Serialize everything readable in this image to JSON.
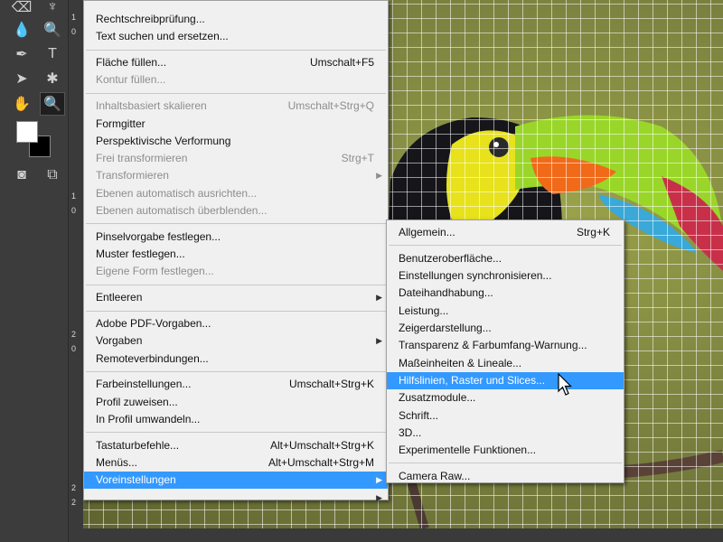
{
  "toolbar": {
    "tools": [
      {
        "icon": "eraser-icon",
        "glyph": "⌫"
      },
      {
        "icon": "paint-bucket-icon",
        "glyph": "♆"
      },
      {
        "icon": "blur-icon",
        "glyph": "💧"
      },
      {
        "icon": "dodge-icon",
        "glyph": "🔍"
      },
      {
        "icon": "pen-icon",
        "glyph": "✒"
      },
      {
        "icon": "type-icon",
        "glyph": "T"
      },
      {
        "icon": "path-select-icon",
        "glyph": "➤"
      },
      {
        "icon": "custom-shape-icon",
        "glyph": "✱"
      },
      {
        "icon": "hand-icon",
        "glyph": "✋"
      },
      {
        "icon": "zoom-icon",
        "glyph": "🔍"
      },
      {
        "icon": "quick-mask-icon",
        "glyph": "◙"
      },
      {
        "icon": "screen-mode-icon",
        "glyph": "⧉"
      }
    ],
    "foreground_color": "#ffffff",
    "background_color": "#000000"
  },
  "ruler": {
    "labels": [
      "1",
      "0",
      "1",
      "0",
      "2",
      "0",
      "2",
      "2"
    ]
  },
  "edit_menu": {
    "groups": [
      [
        {
          "label": "Rechtschreibprüfung...",
          "shortcut": "",
          "disabled": false
        },
        {
          "label": "Text suchen und ersetzen...",
          "shortcut": "",
          "disabled": false
        }
      ],
      [
        {
          "label": "Fläche füllen...",
          "shortcut": "Umschalt+F5",
          "disabled": false
        },
        {
          "label": "Kontur füllen...",
          "shortcut": "",
          "disabled": true
        }
      ],
      [
        {
          "label": "Inhaltsbasiert skalieren",
          "shortcut": "Umschalt+Strg+Q",
          "disabled": true
        },
        {
          "label": "Formgitter",
          "shortcut": "",
          "disabled": false
        },
        {
          "label": "Perspektivische Verformung",
          "shortcut": "",
          "disabled": false
        },
        {
          "label": "Frei transformieren",
          "shortcut": "Strg+T",
          "disabled": true
        },
        {
          "label": "Transformieren",
          "shortcut": "",
          "disabled": true,
          "submenu": true
        },
        {
          "label": "Ebenen automatisch ausrichten...",
          "shortcut": "",
          "disabled": true
        },
        {
          "label": "Ebenen automatisch überblenden...",
          "shortcut": "",
          "disabled": true
        }
      ],
      [
        {
          "label": "Pinselvorgabe festlegen...",
          "shortcut": "",
          "disabled": false
        },
        {
          "label": "Muster festlegen...",
          "shortcut": "",
          "disabled": false
        },
        {
          "label": "Eigene Form festlegen...",
          "shortcut": "",
          "disabled": true
        }
      ],
      [
        {
          "label": "Entleeren",
          "shortcut": "",
          "disabled": false,
          "submenu": true
        }
      ],
      [
        {
          "label": "Adobe PDF-Vorgaben...",
          "shortcut": "",
          "disabled": false
        },
        {
          "label": "Vorgaben",
          "shortcut": "",
          "disabled": false,
          "submenu": true
        },
        {
          "label": "Remoteverbindungen...",
          "shortcut": "",
          "disabled": false
        }
      ],
      [
        {
          "label": "Farbeinstellungen...",
          "shortcut": "Umschalt+Strg+K",
          "disabled": false
        },
        {
          "label": "Profil zuweisen...",
          "shortcut": "",
          "disabled": false
        },
        {
          "label": "In Profil umwandeln...",
          "shortcut": "",
          "disabled": false
        }
      ],
      [
        {
          "label": "Tastaturbefehle...",
          "shortcut": "Alt+Umschalt+Strg+K",
          "disabled": false
        },
        {
          "label": "Menüs...",
          "shortcut": "Alt+Umschalt+Strg+M",
          "disabled": false
        },
        {
          "label": "Voreinstellungen",
          "shortcut": "",
          "disabled": false,
          "submenu": true,
          "highlighted": true
        },
        {
          "label": "",
          "shortcut": "",
          "disabled": false,
          "submenu": true
        }
      ]
    ]
  },
  "preferences_menu": {
    "groups": [
      [
        {
          "label": "Allgemein...",
          "shortcut": "Strg+K"
        }
      ],
      [
        {
          "label": "Benutzeroberfläche...",
          "shortcut": ""
        },
        {
          "label": "Einstellungen synchronisieren...",
          "shortcut": ""
        },
        {
          "label": "Dateihandhabung...",
          "shortcut": ""
        },
        {
          "label": "Leistung...",
          "shortcut": ""
        },
        {
          "label": "Zeigerdarstellung...",
          "shortcut": ""
        },
        {
          "label": "Transparenz & Farbumfang-Warnung...",
          "shortcut": ""
        },
        {
          "label": "Maßeinheiten & Lineale...",
          "shortcut": ""
        },
        {
          "label": "Hilfslinien, Raster und Slices...",
          "shortcut": "",
          "highlighted": true
        },
        {
          "label": "Zusatzmodule...",
          "shortcut": ""
        },
        {
          "label": "Schrift...",
          "shortcut": ""
        },
        {
          "label": "3D...",
          "shortcut": ""
        },
        {
          "label": "Experimentelle Funktionen...",
          "shortcut": ""
        }
      ],
      [
        {
          "label": "Camera Raw...",
          "shortcut": ""
        }
      ]
    ]
  }
}
